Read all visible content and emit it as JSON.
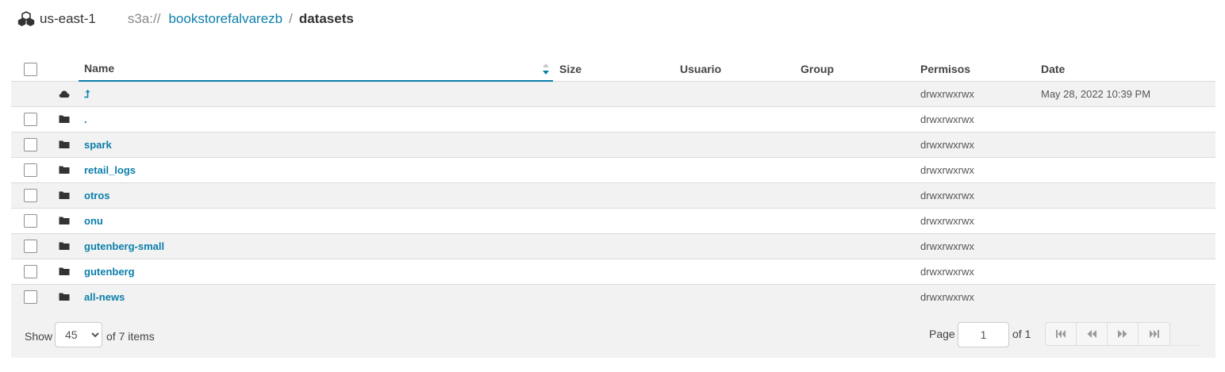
{
  "breadcrumb": {
    "region": "us-east-1",
    "scheme": "s3a://",
    "bucket": "bookstorefalvarezb",
    "separator": "/",
    "current": "datasets"
  },
  "table": {
    "headers": {
      "name": "Name",
      "size": "Size",
      "user": "Usuario",
      "group": "Group",
      "permissions": "Permisos",
      "date": "Date"
    },
    "rows": [
      {
        "name": "⮥",
        "type": "parent",
        "icon": "cloud-icon",
        "permissions": "drwxrwxrwx",
        "date": "May 28, 2022 10:39 PM"
      },
      {
        "name": ".",
        "type": "folder",
        "icon": "folder-icon",
        "permissions": "drwxrwxrwx",
        "date": ""
      },
      {
        "name": "spark",
        "type": "folder",
        "icon": "folder-icon",
        "permissions": "drwxrwxrwx",
        "date": ""
      },
      {
        "name": "retail_logs",
        "type": "folder",
        "icon": "folder-icon",
        "permissions": "drwxrwxrwx",
        "date": ""
      },
      {
        "name": "otros",
        "type": "folder",
        "icon": "folder-icon",
        "permissions": "drwxrwxrwx",
        "date": ""
      },
      {
        "name": "onu",
        "type": "folder",
        "icon": "folder-icon",
        "permissions": "drwxrwxrwx",
        "date": ""
      },
      {
        "name": "gutenberg-small",
        "type": "folder",
        "icon": "folder-icon",
        "permissions": "drwxrwxrwx",
        "date": ""
      },
      {
        "name": "gutenberg",
        "type": "folder",
        "icon": "folder-icon",
        "permissions": "drwxrwxrwx",
        "date": ""
      },
      {
        "name": "all-news",
        "type": "folder",
        "icon": "folder-icon",
        "permissions": "drwxrwxrwx",
        "date": ""
      }
    ]
  },
  "footer": {
    "show_label": "Show",
    "page_size": "45",
    "items_label": "of 7 items",
    "page_label": "Page",
    "page_value": "1",
    "of_pages": "of 1"
  },
  "colors": {
    "link": "#0b7fab",
    "row_alt": "#f2f2f2"
  }
}
